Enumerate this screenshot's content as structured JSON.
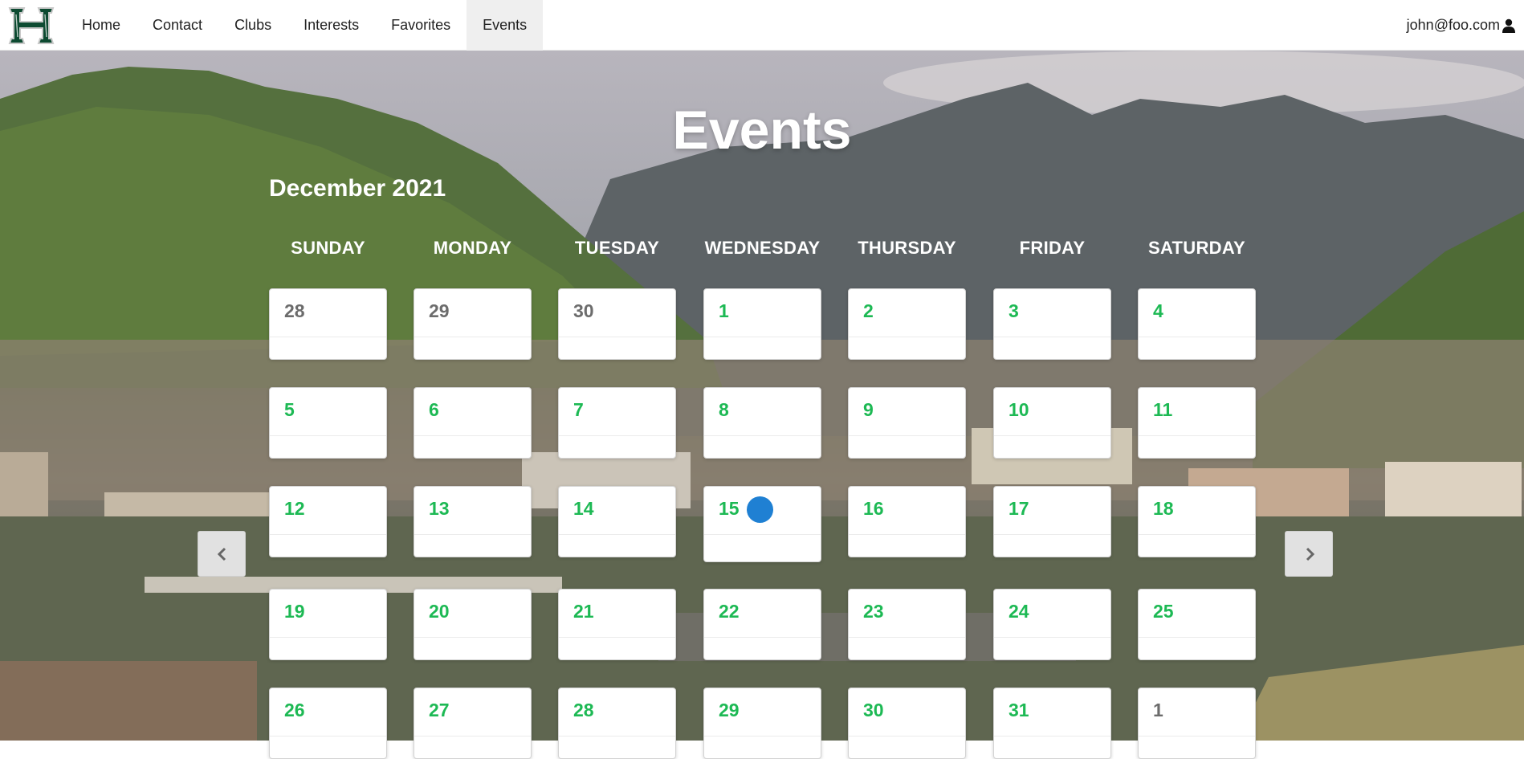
{
  "nav": {
    "logo_icon": "hawaii-h-logo-icon",
    "items": [
      {
        "label": "Home"
      },
      {
        "label": "Contact"
      },
      {
        "label": "Clubs"
      },
      {
        "label": "Interests"
      },
      {
        "label": "Favorites"
      },
      {
        "label": "Events",
        "active": true
      }
    ],
    "user_email": "john@foo.com",
    "user_icon": "user-icon"
  },
  "page": {
    "title": "Events"
  },
  "calendar": {
    "month_label": "December 2021",
    "weekdays": [
      "SUNDAY",
      "MONDAY",
      "TUESDAY",
      "WEDNESDAY",
      "THURSDAY",
      "FRIDAY",
      "SATURDAY"
    ],
    "weeks": [
      [
        {
          "day": "28",
          "other": true
        },
        {
          "day": "29",
          "other": true
        },
        {
          "day": "30",
          "other": true
        },
        {
          "day": "1"
        },
        {
          "day": "2"
        },
        {
          "day": "3"
        },
        {
          "day": "4"
        }
      ],
      [
        {
          "day": "5"
        },
        {
          "day": "6"
        },
        {
          "day": "7"
        },
        {
          "day": "8"
        },
        {
          "day": "9"
        },
        {
          "day": "10"
        },
        {
          "day": "11"
        }
      ],
      [
        {
          "day": "12"
        },
        {
          "day": "13"
        },
        {
          "day": "14"
        },
        {
          "day": "15",
          "event": true
        },
        {
          "day": "16"
        },
        {
          "day": "17"
        },
        {
          "day": "18"
        }
      ],
      [
        {
          "day": "19"
        },
        {
          "day": "20"
        },
        {
          "day": "21"
        },
        {
          "day": "22"
        },
        {
          "day": "23"
        },
        {
          "day": "24"
        },
        {
          "day": "25"
        }
      ],
      [
        {
          "day": "26"
        },
        {
          "day": "27"
        },
        {
          "day": "28"
        },
        {
          "day": "29"
        },
        {
          "day": "30"
        },
        {
          "day": "31"
        },
        {
          "day": "1",
          "other": true
        }
      ]
    ],
    "prev_icon": "chevron-left-icon",
    "next_icon": "chevron-right-icon",
    "colors": {
      "day_number": "#1db954",
      "other_month_number": "#6c6c6c",
      "event_dot": "#1f80d3"
    }
  }
}
